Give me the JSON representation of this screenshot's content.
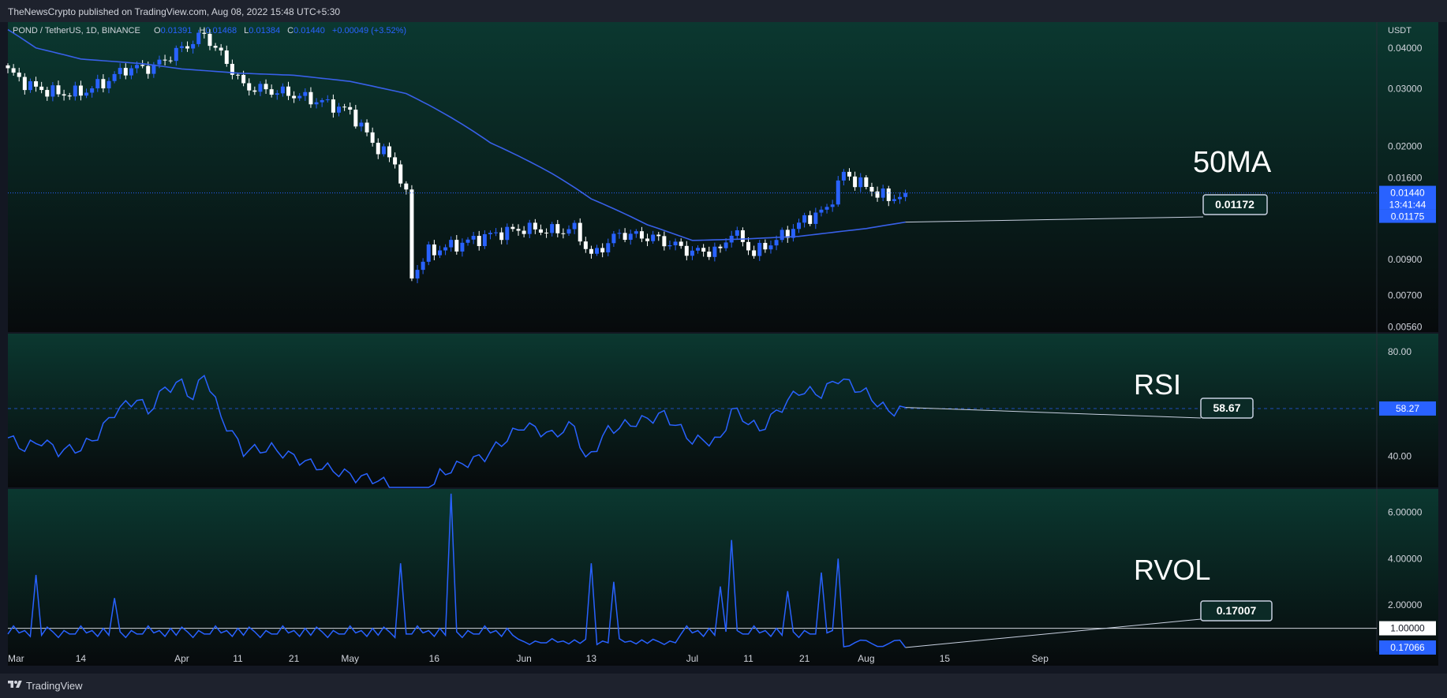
{
  "header": {
    "published_text": "TheNewsCrypto published on TradingView.com, Aug 08, 2022 15:48 UTC+5:30"
  },
  "footer": {
    "brand": "TradingView"
  },
  "colors": {
    "background": "#131722",
    "panel_top": "#0b3830",
    "panel_bottom": "#070b0d",
    "accent_blue": "#2962ff",
    "ma_line": "#3860e8",
    "candle_up": "#2962ff",
    "candle_down": "#ffffff",
    "text": "#d1d4dc",
    "separator": "#2a2e39"
  },
  "legend": {
    "symbol": "POND / TetherUS, 1D, BINANCE",
    "o_label": "O",
    "o_value": "0.01391",
    "h_label": "H",
    "h_value": "0.01468",
    "l_label": "L",
    "l_value": "0.01384",
    "c_label": "C",
    "c_value": "0.01440",
    "change": "+0.00049 (+3.52%)"
  },
  "chart_data": [
    {
      "type": "candlestick",
      "title": "POND / TetherUS, 1D, BINANCE",
      "currency": "USDT",
      "scale": "log",
      "ylim": [
        0.0054,
        0.048
      ],
      "xlim": [
        "2022-03-01",
        "2022-09-01"
      ],
      "x_ticks": [
        "Mar",
        "14",
        "Apr",
        "11",
        "21",
        "May",
        "16",
        "Jun",
        "13",
        "Jul",
        "11",
        "21",
        "Aug",
        "15",
        "Sep"
      ],
      "x_tick_dates": [
        "2022-03-01",
        "2022-03-14",
        "2022-04-01",
        "2022-04-11",
        "2022-04-21",
        "2022-05-01",
        "2022-05-16",
        "2022-06-01",
        "2022-06-13",
        "2022-07-01",
        "2022-07-11",
        "2022-07-21",
        "2022-08-01",
        "2022-08-15",
        "2022-09-01"
      ],
      "y_ticks": [
        "0.04000",
        "0.03000",
        "0.02000",
        "0.01600",
        "0.00900",
        "0.00700",
        "0.00560"
      ],
      "y_tick_values": [
        0.04,
        0.03,
        0.02,
        0.016,
        0.009,
        0.007,
        0.0056
      ],
      "annotation": "50MA",
      "ma_label": "0.01172",
      "last_price_label": "0.01440",
      "countdown_label": "13:41:44",
      "ma_axis_label": "0.01175",
      "last_price": 0.0144,
      "close_anchors": [
        {
          "date": "2022-03-01",
          "close": 0.034
        },
        {
          "date": "2022-03-05",
          "close": 0.0305
        },
        {
          "date": "2022-03-10",
          "close": 0.029
        },
        {
          "date": "2022-03-14",
          "close": 0.0292
        },
        {
          "date": "2022-03-18",
          "close": 0.0312
        },
        {
          "date": "2022-03-22",
          "close": 0.0345
        },
        {
          "date": "2022-03-27",
          "close": 0.035
        },
        {
          "date": "2022-04-01",
          "close": 0.0398
        },
        {
          "date": "2022-04-05",
          "close": 0.044
        },
        {
          "date": "2022-04-08",
          "close": 0.038
        },
        {
          "date": "2022-04-12",
          "close": 0.0305
        },
        {
          "date": "2022-04-20",
          "close": 0.029
        },
        {
          "date": "2022-04-27",
          "close": 0.027
        },
        {
          "date": "2022-05-01",
          "close": 0.0255
        },
        {
          "date": "2022-05-05",
          "close": 0.0205
        },
        {
          "date": "2022-05-09",
          "close": 0.0178
        },
        {
          "date": "2022-05-11",
          "close": 0.014
        },
        {
          "date": "2022-05-12",
          "close": 0.008
        },
        {
          "date": "2022-05-15",
          "close": 0.0095
        },
        {
          "date": "2022-05-20",
          "close": 0.01
        },
        {
          "date": "2022-05-27",
          "close": 0.0108
        },
        {
          "date": "2022-06-01",
          "close": 0.0112
        },
        {
          "date": "2022-06-07",
          "close": 0.011
        },
        {
          "date": "2022-06-10",
          "close": 0.0112
        },
        {
          "date": "2022-06-13",
          "close": 0.0092
        },
        {
          "date": "2022-06-18",
          "close": 0.0108
        },
        {
          "date": "2022-06-24",
          "close": 0.0105
        },
        {
          "date": "2022-07-01",
          "close": 0.0095
        },
        {
          "date": "2022-07-06",
          "close": 0.0096
        },
        {
          "date": "2022-07-08",
          "close": 0.011
        },
        {
          "date": "2022-07-12",
          "close": 0.0094
        },
        {
          "date": "2022-07-17",
          "close": 0.0106
        },
        {
          "date": "2022-07-22",
          "close": 0.0122
        },
        {
          "date": "2022-07-25",
          "close": 0.0128
        },
        {
          "date": "2022-07-28",
          "close": 0.0165
        },
        {
          "date": "2022-08-01",
          "close": 0.015
        },
        {
          "date": "2022-08-05",
          "close": 0.0138
        },
        {
          "date": "2022-08-08",
          "close": 0.0144
        }
      ],
      "ma50_anchors": [
        {
          "date": "2022-03-01",
          "value": 0.0455
        },
        {
          "date": "2022-03-06",
          "value": 0.04
        },
        {
          "date": "2022-03-14",
          "value": 0.037
        },
        {
          "date": "2022-03-25",
          "value": 0.0358
        },
        {
          "date": "2022-04-01",
          "value": 0.0345
        },
        {
          "date": "2022-04-11",
          "value": 0.0335
        },
        {
          "date": "2022-04-21",
          "value": 0.033
        },
        {
          "date": "2022-05-01",
          "value": 0.0316
        },
        {
          "date": "2022-05-11",
          "value": 0.029
        },
        {
          "date": "2022-05-16",
          "value": 0.0262
        },
        {
          "date": "2022-05-26",
          "value": 0.0205
        },
        {
          "date": "2022-06-06",
          "value": 0.0165
        },
        {
          "date": "2022-06-13",
          "value": 0.0138
        },
        {
          "date": "2022-06-23",
          "value": 0.0115
        },
        {
          "date": "2022-07-01",
          "value": 0.0103
        },
        {
          "date": "2022-07-10",
          "value": 0.0104
        },
        {
          "date": "2022-07-20",
          "value": 0.0106
        },
        {
          "date": "2022-08-01",
          "value": 0.0112
        },
        {
          "date": "2022-08-08",
          "value": 0.01172
        }
      ]
    },
    {
      "type": "line",
      "title": "RSI",
      "ylim": [
        28,
        87
      ],
      "y_ticks": [
        "80.00",
        "40.00"
      ],
      "y_tick_values": [
        80,
        40
      ],
      "reference_value": 58.27,
      "annotation": "RSI",
      "value_label": "58.67",
      "axis_label": "58.27",
      "anchors": [
        {
          "date": "2022-03-01",
          "value": 47
        },
        {
          "date": "2022-03-04",
          "value": 43
        },
        {
          "date": "2022-03-07",
          "value": 46
        },
        {
          "date": "2022-03-10",
          "value": 42
        },
        {
          "date": "2022-03-14",
          "value": 43
        },
        {
          "date": "2022-03-17",
          "value": 48
        },
        {
          "date": "2022-03-20",
          "value": 57
        },
        {
          "date": "2022-03-24",
          "value": 62
        },
        {
          "date": "2022-03-26",
          "value": 57
        },
        {
          "date": "2022-03-29",
          "value": 66
        },
        {
          "date": "2022-04-01",
          "value": 68
        },
        {
          "date": "2022-04-03",
          "value": 62
        },
        {
          "date": "2022-04-05",
          "value": 72
        },
        {
          "date": "2022-04-08",
          "value": 55
        },
        {
          "date": "2022-04-12",
          "value": 42
        },
        {
          "date": "2022-04-17",
          "value": 43
        },
        {
          "date": "2022-04-24",
          "value": 37
        },
        {
          "date": "2022-04-29",
          "value": 34
        },
        {
          "date": "2022-05-02",
          "value": 32
        },
        {
          "date": "2022-05-06",
          "value": 31
        },
        {
          "date": "2022-05-09",
          "value": 27
        },
        {
          "date": "2022-05-12",
          "value": 16
        },
        {
          "date": "2022-05-15",
          "value": 26
        },
        {
          "date": "2022-05-17",
          "value": 33
        },
        {
          "date": "2022-05-21",
          "value": 37
        },
        {
          "date": "2022-05-25",
          "value": 40
        },
        {
          "date": "2022-06-01",
          "value": 52
        },
        {
          "date": "2022-06-06",
          "value": 48
        },
        {
          "date": "2022-06-10",
          "value": 52
        },
        {
          "date": "2022-06-12",
          "value": 38
        },
        {
          "date": "2022-06-16",
          "value": 50
        },
        {
          "date": "2022-06-21",
          "value": 53
        },
        {
          "date": "2022-06-26",
          "value": 56
        },
        {
          "date": "2022-07-01",
          "value": 46
        },
        {
          "date": "2022-07-06",
          "value": 46
        },
        {
          "date": "2022-07-08",
          "value": 58
        },
        {
          "date": "2022-07-13",
          "value": 50
        },
        {
          "date": "2022-07-17",
          "value": 59
        },
        {
          "date": "2022-07-20",
          "value": 65
        },
        {
          "date": "2022-07-24",
          "value": 64
        },
        {
          "date": "2022-07-27",
          "value": 70
        },
        {
          "date": "2022-08-01",
          "value": 64
        },
        {
          "date": "2022-08-05",
          "value": 57
        },
        {
          "date": "2022-08-08",
          "value": 58.67
        }
      ]
    },
    {
      "type": "line",
      "title": "RVOL",
      "ylim": [
        0,
        7
      ],
      "y_ticks": [
        "6.00000",
        "4.00000",
        "2.00000"
      ],
      "y_tick_values": [
        6,
        4,
        2
      ],
      "reference_value": 1.0,
      "annotation": "RVOL",
      "value_label": "0.17007",
      "reference_label": "1.00000",
      "axis_label": "0.17066",
      "baseline": [
        0.75,
        1.1,
        0.8,
        0.9,
        0.65,
        1.0,
        0.7,
        1.05,
        0.85,
        0.6,
        0.9,
        0.75
      ],
      "spikes": [
        {
          "date": "2022-03-06",
          "value": 3.3
        },
        {
          "date": "2022-03-20",
          "value": 2.3
        },
        {
          "date": "2022-05-10",
          "value": 3.8
        },
        {
          "date": "2022-05-19",
          "value": 6.8
        },
        {
          "date": "2022-06-13",
          "value": 3.8
        },
        {
          "date": "2022-06-17",
          "value": 3.0
        },
        {
          "date": "2022-07-06",
          "value": 2.8
        },
        {
          "date": "2022-07-08",
          "value": 4.8
        },
        {
          "date": "2022-07-18",
          "value": 2.6
        },
        {
          "date": "2022-07-24",
          "value": 3.4
        },
        {
          "date": "2022-07-27",
          "value": 4.0
        }
      ],
      "last_value": 0.17066
    }
  ]
}
